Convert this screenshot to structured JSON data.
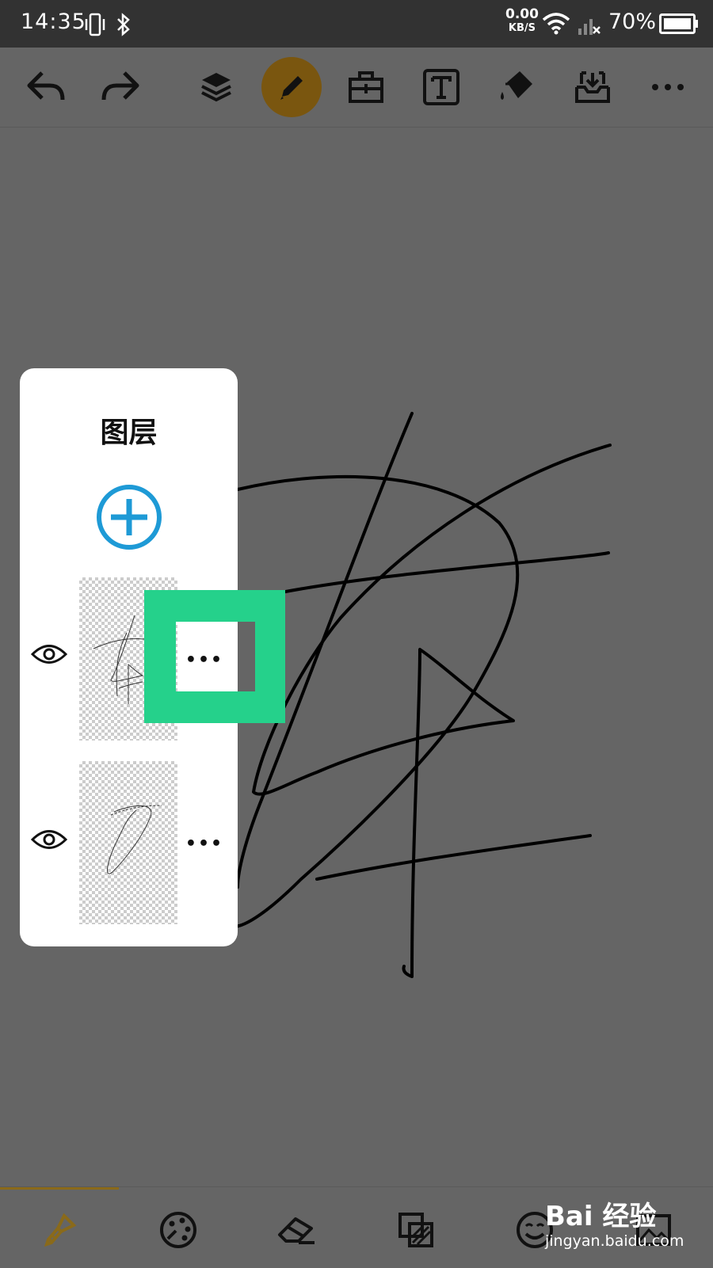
{
  "status_bar": {
    "time": "14:35",
    "net_speed_value": "0.00",
    "net_speed_unit": "KB/S",
    "battery": "70%"
  },
  "toolbar": {
    "icons": [
      "undo-icon",
      "redo-icon",
      "layers-icon",
      "pencil-icon",
      "toolbox-icon",
      "text-icon",
      "paint-bucket-icon",
      "save-tray-icon",
      "more-icon"
    ],
    "active": "pencil-icon"
  },
  "layers_panel": {
    "title": "图层",
    "layers": [
      {
        "visible": true,
        "more_label": "•••"
      },
      {
        "visible": true,
        "more_label": "•••"
      }
    ]
  },
  "bottom_bar": {
    "icons": [
      "brush-icon",
      "palette-icon",
      "eraser-icon",
      "layer-blend-icon",
      "emoji-icon",
      "image-icon"
    ],
    "active": "brush-icon"
  },
  "watermark": {
    "brand": "Bai 经验",
    "url": "jingyan.baidu.com"
  },
  "colors": {
    "accent_gold": "#7a560f",
    "highlight_green": "#25d18b",
    "add_blue": "#1e9ad6",
    "canvas_gray": "#656565"
  }
}
